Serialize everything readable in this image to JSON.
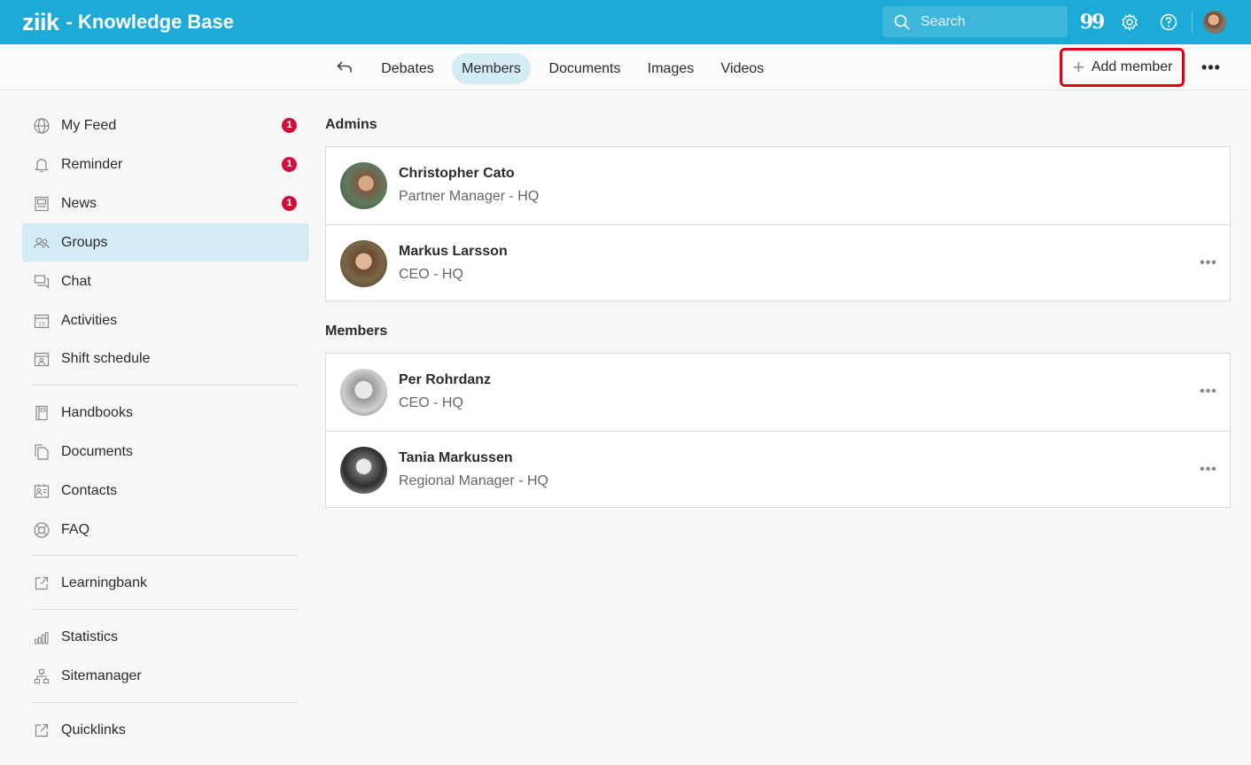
{
  "header": {
    "logo": "ziik",
    "title": "- Knowledge Base",
    "search_placeholder": "Search",
    "quote_glyph": "99"
  },
  "tabs": {
    "debates": "Debates",
    "members": "Members",
    "documents": "Documents",
    "images": "Images",
    "videos": "Videos",
    "add_member": "Add member"
  },
  "sidebar": {
    "items": [
      {
        "label": "My Feed",
        "badge": "1",
        "icon": "globe-icon"
      },
      {
        "label": "Reminder",
        "badge": "1",
        "icon": "bell-icon"
      },
      {
        "label": "News",
        "badge": "1",
        "icon": "newspaper-icon"
      },
      {
        "label": "Groups",
        "icon": "groups-icon"
      },
      {
        "label": "Chat",
        "icon": "chat-icon"
      },
      {
        "label": "Activities",
        "icon": "calendar-icon"
      },
      {
        "label": "Shift schedule",
        "icon": "schedule-icon"
      },
      {
        "label": "Handbooks",
        "icon": "book-icon"
      },
      {
        "label": "Documents",
        "icon": "documents-icon"
      },
      {
        "label": "Contacts",
        "icon": "contacts-icon"
      },
      {
        "label": "FAQ",
        "icon": "lifebuoy-icon"
      },
      {
        "label": "Learningbank",
        "icon": "external-link-icon"
      },
      {
        "label": "Statistics",
        "icon": "bar-chart-icon"
      },
      {
        "label": "Sitemanager",
        "icon": "sitemap-icon"
      },
      {
        "label": "Quicklinks",
        "icon": "external-link-icon"
      }
    ]
  },
  "main": {
    "admins_title": "Admins",
    "members_title": "Members",
    "admins": [
      {
        "name": "Christopher Cato",
        "role": "Partner Manager - HQ"
      },
      {
        "name": "Markus Larsson",
        "role": "CEO - HQ"
      }
    ],
    "members": [
      {
        "name": "Per Rohrdanz",
        "role": "CEO - HQ"
      },
      {
        "name": "Tania Markussen",
        "role": "Regional Manager - HQ"
      }
    ]
  },
  "colors": {
    "brand": "#1eaad6",
    "active_bg": "#d3ecf6",
    "badge": "#d0103a",
    "highlight": "#e00012"
  }
}
